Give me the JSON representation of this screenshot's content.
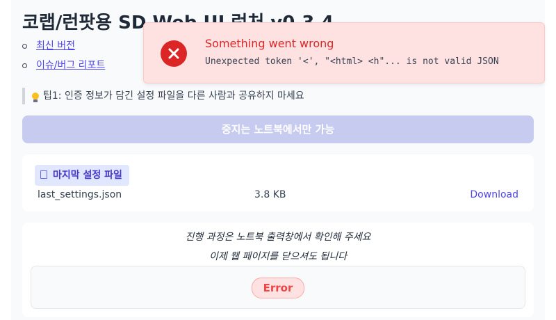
{
  "header": {
    "title": "코랩/런팟용 SD Web UI 런처 v0.3.4"
  },
  "links": [
    {
      "label": "최신 버전"
    },
    {
      "label": "이슈/버그 리포트"
    }
  ],
  "tip": {
    "text": "팁1: 인증 정보가 담긴 설정 파일을 다른 사람과 공유하지 마세요",
    "icon": "lightbulb-icon"
  },
  "stop_button": {
    "label": "중지는 노트북에서만 가능"
  },
  "file_card": {
    "label": "마지막 설정 파일",
    "icon": "document-icon",
    "file": {
      "name": "last_settings.json",
      "size": "3.8 KB",
      "action": "Download"
    }
  },
  "progress": {
    "message1": "진행 과정은 노트북 출력창에서 확인해 주세요",
    "message2": "이제 웹 페이지를 닫으셔도 됩니다",
    "status": "Error"
  },
  "toast": {
    "title": "Something went wrong",
    "message": "Unexpected token '<', \"<html> <h\"... is not valid JSON",
    "icon": "error-icon"
  },
  "colors": {
    "accent": "#4f46e5",
    "error": "#dc2626",
    "error_bg": "#fee2e2",
    "disabled_button": "#c7cbf0"
  }
}
